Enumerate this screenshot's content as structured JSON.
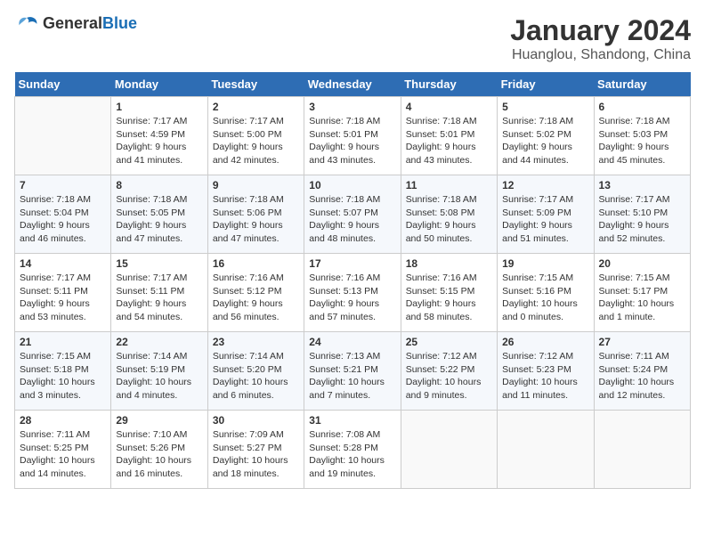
{
  "app": {
    "name_general": "General",
    "name_blue": "Blue"
  },
  "title": {
    "month_year": "January 2024",
    "location": "Huanglou, Shandong, China"
  },
  "calendar": {
    "days_of_week": [
      "Sunday",
      "Monday",
      "Tuesday",
      "Wednesday",
      "Thursday",
      "Friday",
      "Saturday"
    ],
    "weeks": [
      [
        {
          "day": "",
          "info": ""
        },
        {
          "day": "1",
          "info": "Sunrise: 7:17 AM\nSunset: 4:59 PM\nDaylight: 9 hours\nand 41 minutes."
        },
        {
          "day": "2",
          "info": "Sunrise: 7:17 AM\nSunset: 5:00 PM\nDaylight: 9 hours\nand 42 minutes."
        },
        {
          "day": "3",
          "info": "Sunrise: 7:18 AM\nSunset: 5:01 PM\nDaylight: 9 hours\nand 43 minutes."
        },
        {
          "day": "4",
          "info": "Sunrise: 7:18 AM\nSunset: 5:01 PM\nDaylight: 9 hours\nand 43 minutes."
        },
        {
          "day": "5",
          "info": "Sunrise: 7:18 AM\nSunset: 5:02 PM\nDaylight: 9 hours\nand 44 minutes."
        },
        {
          "day": "6",
          "info": "Sunrise: 7:18 AM\nSunset: 5:03 PM\nDaylight: 9 hours\nand 45 minutes."
        }
      ],
      [
        {
          "day": "7",
          "info": "Sunrise: 7:18 AM\nSunset: 5:04 PM\nDaylight: 9 hours\nand 46 minutes."
        },
        {
          "day": "8",
          "info": "Sunrise: 7:18 AM\nSunset: 5:05 PM\nDaylight: 9 hours\nand 47 minutes."
        },
        {
          "day": "9",
          "info": "Sunrise: 7:18 AM\nSunset: 5:06 PM\nDaylight: 9 hours\nand 47 minutes."
        },
        {
          "day": "10",
          "info": "Sunrise: 7:18 AM\nSunset: 5:07 PM\nDaylight: 9 hours\nand 48 minutes."
        },
        {
          "day": "11",
          "info": "Sunrise: 7:18 AM\nSunset: 5:08 PM\nDaylight: 9 hours\nand 50 minutes."
        },
        {
          "day": "12",
          "info": "Sunrise: 7:17 AM\nSunset: 5:09 PM\nDaylight: 9 hours\nand 51 minutes."
        },
        {
          "day": "13",
          "info": "Sunrise: 7:17 AM\nSunset: 5:10 PM\nDaylight: 9 hours\nand 52 minutes."
        }
      ],
      [
        {
          "day": "14",
          "info": "Sunrise: 7:17 AM\nSunset: 5:11 PM\nDaylight: 9 hours\nand 53 minutes."
        },
        {
          "day": "15",
          "info": "Sunrise: 7:17 AM\nSunset: 5:11 PM\nDaylight: 9 hours\nand 54 minutes."
        },
        {
          "day": "16",
          "info": "Sunrise: 7:16 AM\nSunset: 5:12 PM\nDaylight: 9 hours\nand 56 minutes."
        },
        {
          "day": "17",
          "info": "Sunrise: 7:16 AM\nSunset: 5:13 PM\nDaylight: 9 hours\nand 57 minutes."
        },
        {
          "day": "18",
          "info": "Sunrise: 7:16 AM\nSunset: 5:15 PM\nDaylight: 9 hours\nand 58 minutes."
        },
        {
          "day": "19",
          "info": "Sunrise: 7:15 AM\nSunset: 5:16 PM\nDaylight: 10 hours\nand 0 minutes."
        },
        {
          "day": "20",
          "info": "Sunrise: 7:15 AM\nSunset: 5:17 PM\nDaylight: 10 hours\nand 1 minute."
        }
      ],
      [
        {
          "day": "21",
          "info": "Sunrise: 7:15 AM\nSunset: 5:18 PM\nDaylight: 10 hours\nand 3 minutes."
        },
        {
          "day": "22",
          "info": "Sunrise: 7:14 AM\nSunset: 5:19 PM\nDaylight: 10 hours\nand 4 minutes."
        },
        {
          "day": "23",
          "info": "Sunrise: 7:14 AM\nSunset: 5:20 PM\nDaylight: 10 hours\nand 6 minutes."
        },
        {
          "day": "24",
          "info": "Sunrise: 7:13 AM\nSunset: 5:21 PM\nDaylight: 10 hours\nand 7 minutes."
        },
        {
          "day": "25",
          "info": "Sunrise: 7:12 AM\nSunset: 5:22 PM\nDaylight: 10 hours\nand 9 minutes."
        },
        {
          "day": "26",
          "info": "Sunrise: 7:12 AM\nSunset: 5:23 PM\nDaylight: 10 hours\nand 11 minutes."
        },
        {
          "day": "27",
          "info": "Sunrise: 7:11 AM\nSunset: 5:24 PM\nDaylight: 10 hours\nand 12 minutes."
        }
      ],
      [
        {
          "day": "28",
          "info": "Sunrise: 7:11 AM\nSunset: 5:25 PM\nDaylight: 10 hours\nand 14 minutes."
        },
        {
          "day": "29",
          "info": "Sunrise: 7:10 AM\nSunset: 5:26 PM\nDaylight: 10 hours\nand 16 minutes."
        },
        {
          "day": "30",
          "info": "Sunrise: 7:09 AM\nSunset: 5:27 PM\nDaylight: 10 hours\nand 18 minutes."
        },
        {
          "day": "31",
          "info": "Sunrise: 7:08 AM\nSunset: 5:28 PM\nDaylight: 10 hours\nand 19 minutes."
        },
        {
          "day": "",
          "info": ""
        },
        {
          "day": "",
          "info": ""
        },
        {
          "day": "",
          "info": ""
        }
      ]
    ]
  }
}
